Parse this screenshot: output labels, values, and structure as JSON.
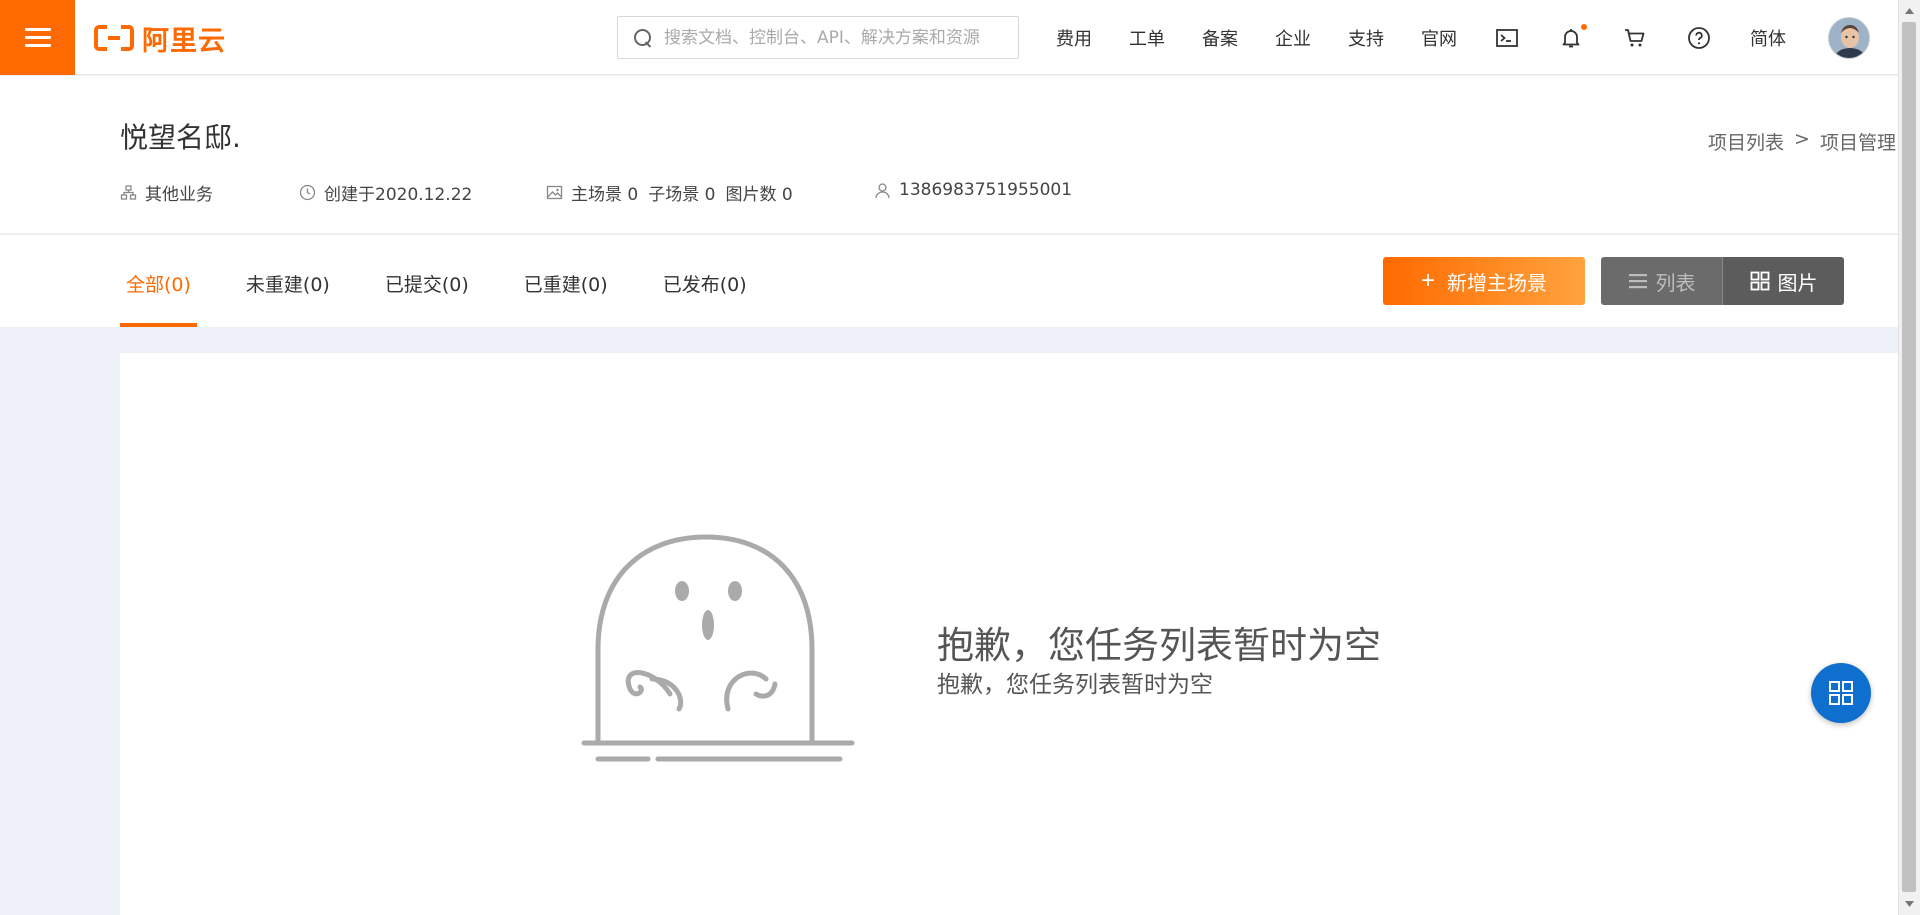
{
  "topbar": {
    "logo_text": "阿里云",
    "search_placeholder": "搜索文档、控制台、API、解决方案和资源",
    "nav": [
      "费用",
      "工单",
      "备案",
      "企业",
      "支持",
      "官网"
    ],
    "icons": [
      "terminal-icon",
      "bell-icon",
      "cart-icon",
      "help-icon"
    ],
    "lang": "简体"
  },
  "project": {
    "title": "悦望名邸.",
    "breadcrumb": [
      "项目列表",
      ">",
      "项目管理"
    ],
    "business": "其他业务",
    "created": "创建于2020.12.22",
    "main_scenes": "主场景 0",
    "sub_scenes": "子场景 0",
    "images": "图片数 0",
    "account": "1386983751955001"
  },
  "tabs": [
    {
      "label": "全部(0)",
      "active": true
    },
    {
      "label": "未重建(0)"
    },
    {
      "label": "已提交(0)"
    },
    {
      "label": "已重建(0)"
    },
    {
      "label": "已发布(0)"
    }
  ],
  "actions": {
    "add_label": "新增主场景",
    "view_list": "列表",
    "view_image": "图片"
  },
  "empty": {
    "title": "抱歉，您任务列表暂时为空",
    "subtitle": "抱歉，您任务列表暂时为空"
  },
  "colors": {
    "accent": "#ff6a00",
    "float_button": "#0f6fcf",
    "page_bg": "#edf0f6"
  }
}
